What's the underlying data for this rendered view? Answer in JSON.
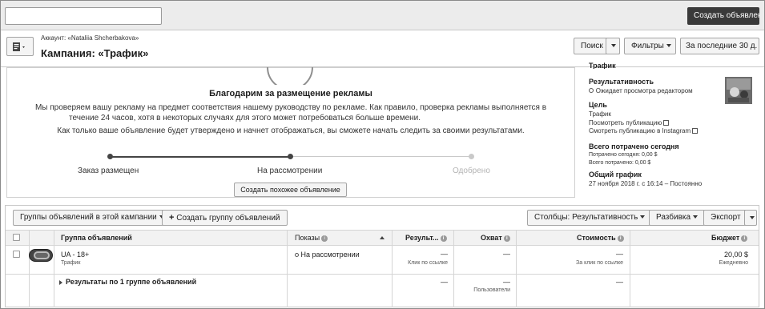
{
  "topbar": {
    "search_placeholder": "",
    "create_ad_label": "Создать объявления"
  },
  "header": {
    "account_label": "Аккаунт: «Nataliia Shcherbakova»",
    "campaign_title": "Кампания: «Трафик»",
    "search_btn": "Поиск",
    "filters_btn": "Фильтры",
    "date_range_btn": "За последние 30 д."
  },
  "review": {
    "title": "Благодарим за размещение рекламы",
    "text_line1": "Мы проверяем вашу рекламу на предмет соответствия нашему руководству по рекламе. Как правило, проверка рекламы выполняется в",
    "text_line2": "течение 24 часов, хотя в некоторых случаях для этого может потребоваться больше времени.",
    "text_line3": "Как только ваше объявление будет утверждено и начнет отображаться, вы сможете начать следить за своими результатами.",
    "steps": [
      "Заказ размещен",
      "На рассмотрении",
      "Одобрено"
    ],
    "completed_steps": 2,
    "similar_btn": "Создать похожее объявление"
  },
  "sidebar": {
    "top_cut": "Трафик",
    "perf_label": "Результативность",
    "perf_value": "Ожидает просмотра редактором",
    "goal_label": "Цель",
    "goal_value": "Трафик",
    "view_post": "Посмотреть публикацию",
    "view_post_ig": "Смотреть публикацию в Instagram",
    "spent_label": "Всего потрачено сегодня",
    "spent_today": "Потрачено сегодня: 0,00 $",
    "spent_total": "Всего потрачено: 0,00 $",
    "schedule_label": "Общий график",
    "schedule_value": "27 ноября 2018 г. с 16:14 – Постоянно"
  },
  "table_toolbar": {
    "groups_dropdown": "Группы объявлений в этой кампании",
    "create_group": "Создать группу объявлений",
    "columns_btn": "Столбцы: Результативность",
    "breakdown_btn": "Разбивка",
    "export_btn": "Экспорт"
  },
  "table": {
    "columns": [
      "Группа объявлений",
      "Показы",
      "Результ...",
      "Охват",
      "Стоимость",
      "Бюджет"
    ],
    "row": {
      "name": "UA - 18+",
      "name_sub": "Трафик",
      "status": "На рассмотрении",
      "results": "—",
      "results_sub": "Клик по ссылке",
      "reach": "—",
      "cost": "—",
      "cost_sub": "За клик по ссылке",
      "budget": "20,00 $",
      "budget_sub": "Ежедневно"
    },
    "summary": {
      "label": "Результаты по 1 группе объявлений",
      "results": "—",
      "reach": "—",
      "reach_sub": "Пользователи",
      "cost": "—"
    }
  }
}
